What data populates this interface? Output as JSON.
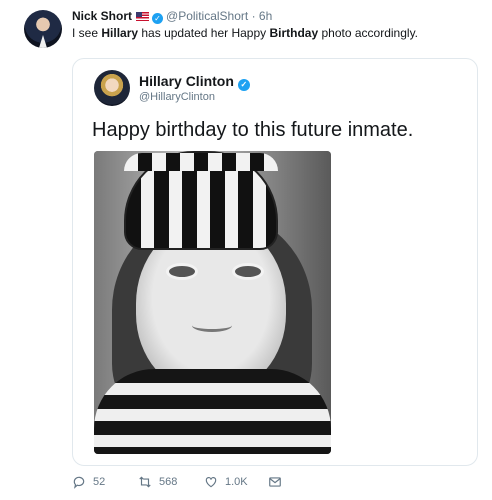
{
  "tweet": {
    "author_name": "Nick Short",
    "handle": "@PoliticalShort",
    "time": "6h",
    "text_1": "I see ",
    "text_bold_1": "Hillary",
    "text_2": " has updated her Happy ",
    "text_bold_2": "Birthday",
    "text_3": " photo accordingly."
  },
  "quoted": {
    "author_name": "Hillary Clinton",
    "handle": "@HillaryClinton",
    "text": "Happy birthday to this future inmate."
  },
  "actions": {
    "reply_count": "52",
    "retweet_count": "568",
    "like_count": "1.0K"
  },
  "icons": [
    "flag-us-icon",
    "verified-icon",
    "reply-icon",
    "retweet-icon",
    "like-icon",
    "message-icon"
  ],
  "colors": {
    "verified": "#1da1f2",
    "muted": "#657786",
    "border": "#e1e8ed"
  }
}
